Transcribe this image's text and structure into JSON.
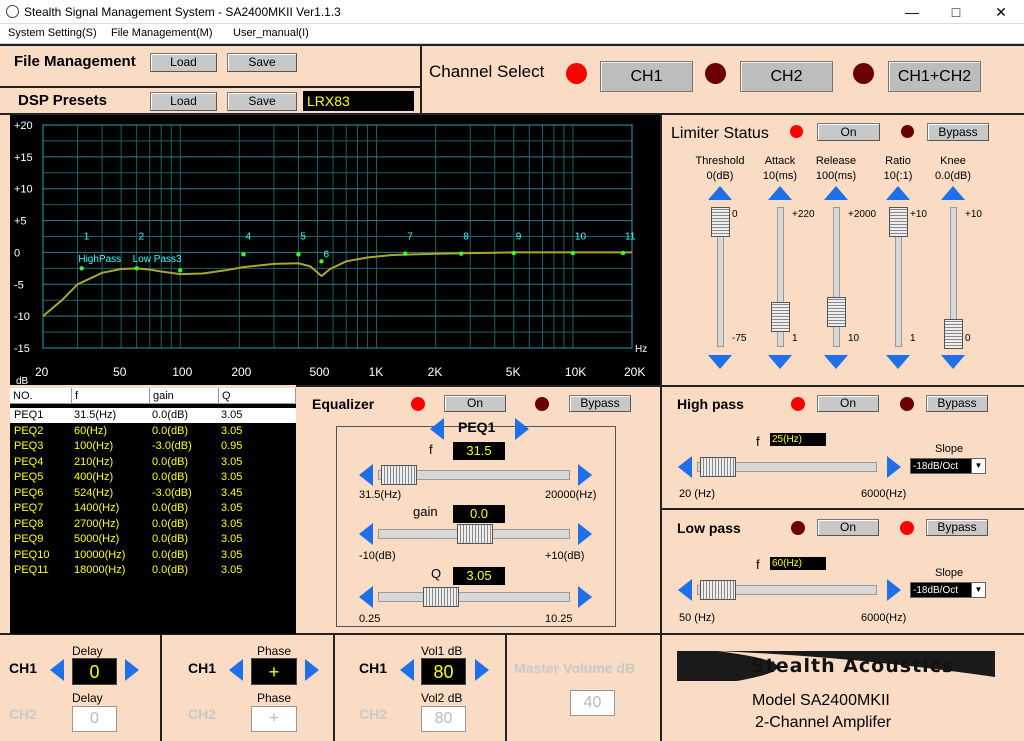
{
  "app": {
    "title": "Stealth Signal Management System - SA2400MKII Ver1.1.3"
  },
  "menu": [
    "System Setting(S)",
    "File Management(M)",
    "User_manual(I)"
  ],
  "file_mgmt": {
    "label": "File Management",
    "load": "Load",
    "save": "Save"
  },
  "dsp": {
    "label": "DSP Presets",
    "load": "Load",
    "save": "Save",
    "preset": "LRX83"
  },
  "channel_select": {
    "label": "Channel Select",
    "ch1": "CH1",
    "ch2": "CH2",
    "both": "CH1+CH2"
  },
  "graph": {
    "y_ticks": [
      "+20",
      "+15",
      "+10",
      "+5",
      "0",
      "-5",
      "-10",
      "-15"
    ],
    "x_ticks": [
      "20",
      "50",
      "100",
      "200",
      "500",
      "1K",
      "2K",
      "5K",
      "10K",
      "20K"
    ],
    "y_unit": "dB",
    "x_unit": "Hz",
    "band_markers": [
      "1",
      "2",
      "4",
      "5",
      "6",
      "7",
      "8",
      "9",
      "10",
      "11"
    ],
    "highpass_label": "HighPass",
    "lowpass_label": "Low Pass3"
  },
  "limiter": {
    "label": "Limiter Status",
    "on": "On",
    "bypass": "Bypass",
    "params": [
      {
        "name": "Threshold",
        "value": "0(dB)",
        "max": "0",
        "min": "-75",
        "level": 1.0
      },
      {
        "name": "Attack",
        "value": "10(ms)",
        "max": "+220",
        "min": "1",
        "level": 0.15
      },
      {
        "name": "Release",
        "value": "100(ms)",
        "max": "+2000",
        "min": "10",
        "level": 0.2
      },
      {
        "name": "Ratio",
        "value": "10(:1)",
        "max": "+10",
        "min": "1",
        "level": 1.0
      },
      {
        "name": "Knee",
        "value": "0.0(dB)",
        "max": "+10",
        "min": "0",
        "level": 0.0
      }
    ]
  },
  "peq_table": {
    "headers": [
      "NO.",
      "f",
      "gain",
      "Q"
    ],
    "rows": [
      [
        "PEQ1",
        "31.5(Hz)",
        "0.0(dB)",
        "3.05"
      ],
      [
        "PEQ2",
        "60(Hz)",
        "0.0(dB)",
        "3.05"
      ],
      [
        "PEQ3",
        "100(Hz)",
        "-3.0(dB)",
        "0.95"
      ],
      [
        "PEQ4",
        "210(Hz)",
        "0.0(dB)",
        "3.05"
      ],
      [
        "PEQ5",
        "400(Hz)",
        "0.0(dB)",
        "3.05"
      ],
      [
        "PEQ6",
        "524(Hz)",
        "-3.0(dB)",
        "3.45"
      ],
      [
        "PEQ7",
        "1400(Hz)",
        "0.0(dB)",
        "3.05"
      ],
      [
        "PEQ8",
        "2700(Hz)",
        "0.0(dB)",
        "3.05"
      ],
      [
        "PEQ9",
        "5000(Hz)",
        "0.0(dB)",
        "3.05"
      ],
      [
        "PEQ10",
        "10000(Hz)",
        "0.0(dB)",
        "3.05"
      ],
      [
        "PEQ11",
        "18000(Hz)",
        "0.0(dB)",
        "3.05"
      ]
    ]
  },
  "equalizer": {
    "label": "Equalizer",
    "on": "On",
    "bypass": "Bypass",
    "band": "PEQ1",
    "f_label": "f",
    "f_value": "31.5",
    "f_min": "31.5(Hz)",
    "f_max": "20000(Hz)",
    "gain_label": "gain",
    "gain_value": "0.0",
    "gain_min": "-10(dB)",
    "gain_max": "+10(dB)",
    "q_label": "Q",
    "q_value": "3.05",
    "q_min": "0.25",
    "q_max": "10.25"
  },
  "highpass": {
    "label": "High pass",
    "on": "On",
    "bypass": "Bypass",
    "f_label": "f",
    "f_value": "25(Hz)",
    "slope_label": "Slope",
    "slope": "-18dB/Oct",
    "min": "20 (Hz)",
    "max": "6000(Hz)"
  },
  "lowpass": {
    "label": "Low pass",
    "on": "On",
    "bypass": "Bypass",
    "f_label": "f",
    "f_value": "60(Hz)",
    "slope_label": "Slope",
    "slope": "-18dB/Oct",
    "min": "50 (Hz)",
    "max": "6000(Hz)"
  },
  "delay": {
    "ch1": "CH1",
    "ch2": "CH2",
    "label1": "Delay",
    "value1": "0",
    "label2": "Delay",
    "value2": "0"
  },
  "phase": {
    "ch1": "CH1",
    "ch2": "CH2",
    "label1": "Phase",
    "value1": "+",
    "label2": "Phase",
    "value2": "+"
  },
  "volume": {
    "ch1": "CH1",
    "ch2": "CH2",
    "label1": "Vol1 dB",
    "value1": "80",
    "label2": "Vol2 dB",
    "value2": "80"
  },
  "master": {
    "label": "Master Volume dB",
    "value": "40"
  },
  "brand": {
    "logo": "Stealth Acoustics",
    "model": "Model SA2400MKII",
    "desc": "2-Channel Amplifer"
  },
  "colors": {
    "accent_blue": "#1e6fe8",
    "led_on": "#ff0000",
    "led_off": "#6b0000",
    "panel": "#f9dcc3",
    "trace": "#a8a830"
  }
}
